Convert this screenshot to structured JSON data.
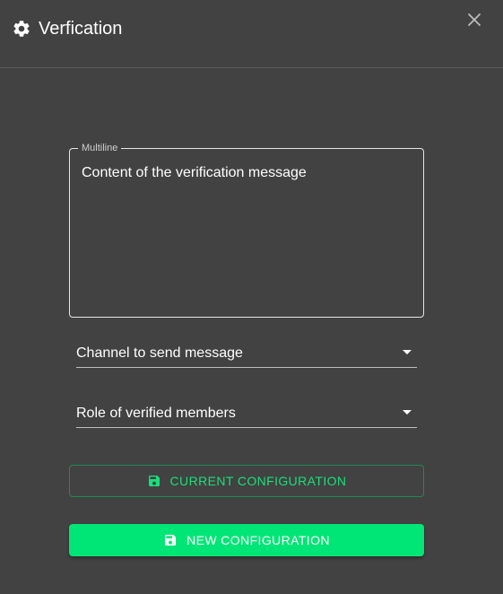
{
  "dialog": {
    "title": "Verfication",
    "icon": "gear-icon",
    "close_icon": "close-icon"
  },
  "message_field": {
    "label": "Multiline",
    "value": "Content of the verification message"
  },
  "channel_select": {
    "value": "Channel to send message"
  },
  "role_select": {
    "value": "Role of verified members"
  },
  "buttons": {
    "current_label": "CURRENT CONFIGURATION",
    "new_label": "NEW CONFIGURATION",
    "icon": "save-icon"
  },
  "colors": {
    "background": "#424242",
    "accent": "#00e676"
  }
}
